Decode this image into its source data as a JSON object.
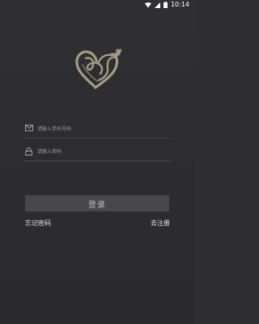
{
  "status_bar": {
    "time": "10:14",
    "icons": [
      "wifi-icon",
      "signal-icon",
      "battery-icon"
    ]
  },
  "logo": {
    "icon": "heart-logo-icon",
    "color": "#a89a80"
  },
  "login_form": {
    "phone": {
      "icon": "mail-icon",
      "placeholder": "请输入手机号码",
      "value": ""
    },
    "password": {
      "icon": "lock-icon",
      "placeholder": "请输入密码",
      "value": ""
    },
    "login_label": "登录"
  },
  "links": {
    "forgot_password": "忘记密码",
    "register": "去注册"
  },
  "colors": {
    "background": "#2e2e32",
    "button": "#47474c",
    "divider": "#46464b",
    "logo_gold": "#a89a80"
  }
}
